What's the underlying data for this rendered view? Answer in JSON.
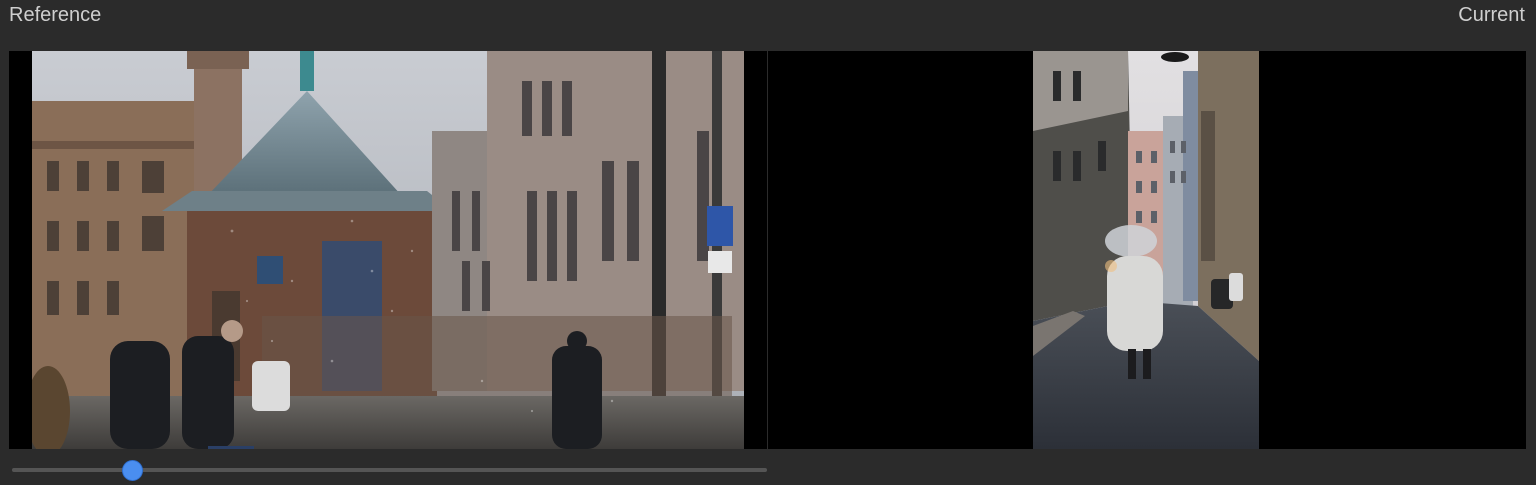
{
  "header": {
    "reference_label": "Reference",
    "current_label": "Current"
  },
  "scrubber": {
    "position": 0.16
  },
  "colors": {
    "background": "#2b2b2b",
    "viewer_background": "#000000",
    "accent": "#4a8ef0"
  }
}
